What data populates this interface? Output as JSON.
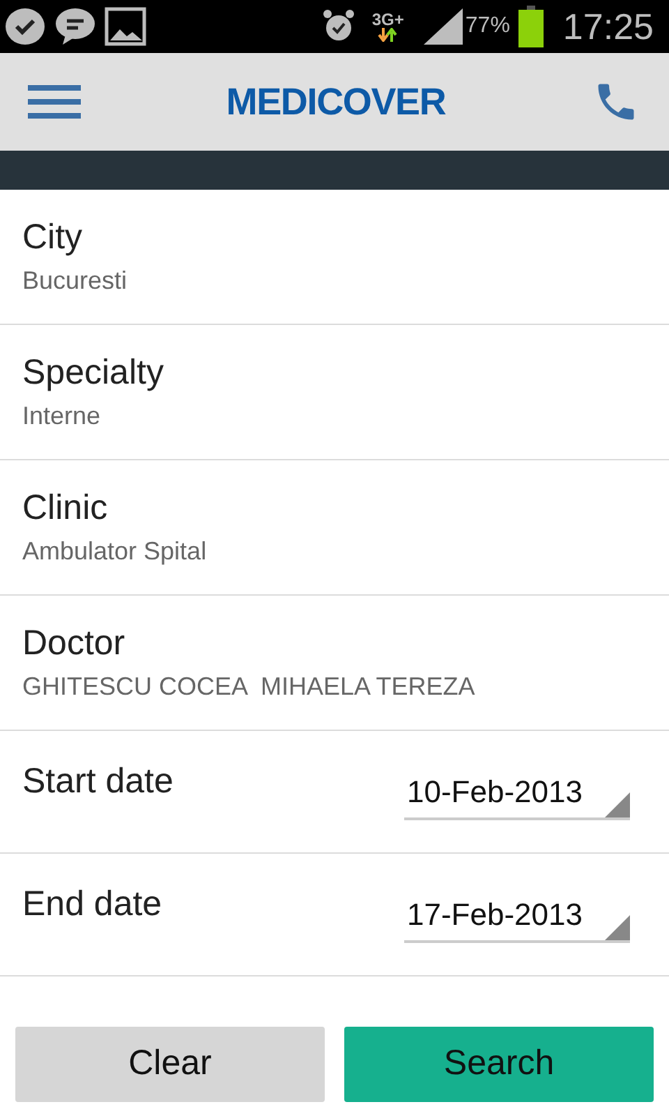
{
  "status_bar": {
    "network": "3G+",
    "battery": "77%",
    "time": "17:25"
  },
  "header": {
    "title": "MEDICOVER"
  },
  "fields": [
    {
      "kind": "field",
      "label": "City",
      "value": "Bucuresti"
    },
    {
      "kind": "field",
      "label": "Specialty",
      "value": "Interne"
    },
    {
      "kind": "field",
      "label": "Clinic",
      "value": "Ambulator Spital"
    },
    {
      "kind": "field",
      "label": "Doctor",
      "value": "GHITESCU COCEA  MIHAELA TEREZA"
    },
    {
      "kind": "date",
      "label": "Start date",
      "value": "10-Feb-2013"
    },
    {
      "kind": "date",
      "label": "End date",
      "value": "17-Feb-2013"
    }
  ],
  "buttons": [
    {
      "kind": "secondary",
      "label": "Clear"
    },
    {
      "kind": "primary",
      "label": "Search"
    }
  ]
}
